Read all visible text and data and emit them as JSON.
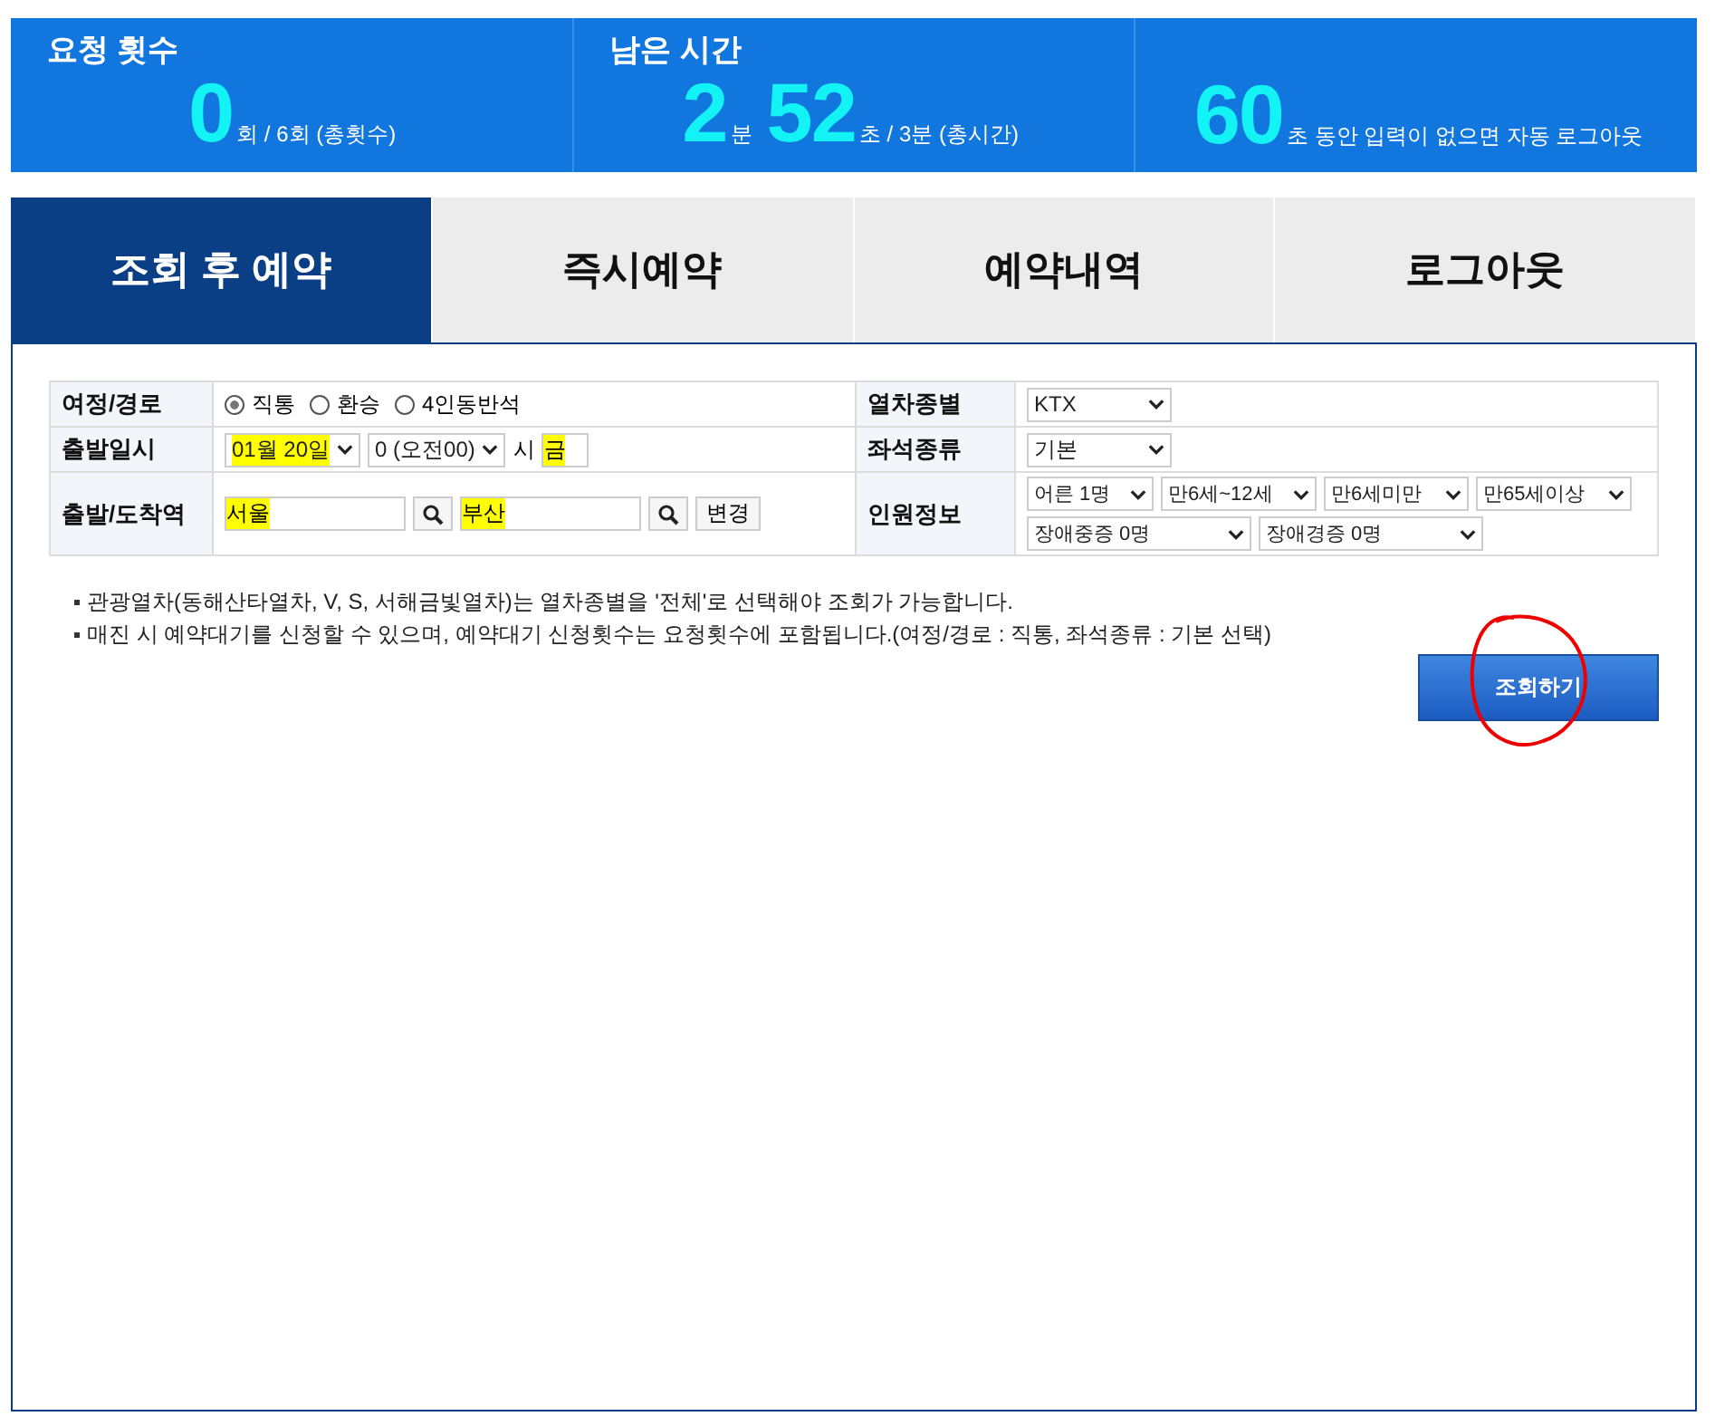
{
  "stats": [
    {
      "label": "요청 횟수",
      "parts": [
        {
          "kind": "big",
          "text": "0"
        },
        {
          "kind": "small",
          "text": "회 / 6회 (총횟수)"
        }
      ]
    },
    {
      "label": "남은 시간",
      "parts": [
        {
          "kind": "big",
          "text": "2"
        },
        {
          "kind": "small",
          "text": "분"
        },
        {
          "kind": "big",
          "text": "52"
        },
        {
          "kind": "small",
          "text": "초 / 3분 (총시간)"
        }
      ]
    },
    {
      "parts": [
        {
          "kind": "big",
          "text": "60"
        },
        {
          "kind": "small",
          "text": "초 동안 입력이 없으면 자동 로그아웃"
        }
      ]
    }
  ],
  "tabs": [
    {
      "label": "조회 후 예약",
      "selected": true
    },
    {
      "label": "즉시예약",
      "selected": false
    },
    {
      "label": "예약내역",
      "selected": false
    },
    {
      "label": "로그아웃",
      "selected": false
    }
  ],
  "form": {
    "rows": [
      {
        "label": "여정/경로",
        "controls": [
          {
            "kind": "radio",
            "options": [
              {
                "label": "직통",
                "selected": true
              },
              {
                "label": "환승",
                "selected": false
              },
              {
                "label": "4인동반석",
                "selected": false
              }
            ]
          }
        ],
        "label_2": "열차종별",
        "controls_2": [
          {
            "kind": "select",
            "value": "KTX",
            "highlighted": false
          }
        ]
      },
      {
        "label": "출발일시",
        "controls": [
          {
            "kind": "select",
            "value": "01월 20일",
            "highlighted": true
          },
          {
            "kind": "select",
            "value": "0 (오전00)",
            "highlighted": false
          },
          {
            "kind": "text",
            "text": "시"
          },
          {
            "kind": "input",
            "value": "금",
            "highlighted": true
          }
        ],
        "label_2": "좌석종류",
        "controls_2": [
          {
            "kind": "select",
            "value": "기본",
            "highlighted": false
          }
        ]
      },
      {
        "label": "출발/도착역",
        "controls": [
          {
            "kind": "input",
            "value": "서울",
            "highlighted": true
          },
          {
            "kind": "search"
          },
          {
            "kind": "input",
            "value": "부산",
            "highlighted": true
          },
          {
            "kind": "search"
          },
          {
            "kind": "button",
            "label": "변경"
          }
        ],
        "label_2": "인원정보",
        "controls_2": [
          {
            "kind": "select",
            "value": "어른 1명",
            "highlighted": false
          },
          {
            "kind": "select",
            "value": "만6세~12세",
            "highlighted": false
          },
          {
            "kind": "select",
            "value": "만6세미만",
            "highlighted": false
          },
          {
            "kind": "select",
            "value": "만65세이상",
            "highlighted": false
          },
          {
            "kind": "select",
            "value": "장애중증 0명",
            "highlighted": false
          },
          {
            "kind": "select",
            "value": "장애경증 0명",
            "highlighted": false
          }
        ]
      }
    ]
  },
  "notes": [
    "관광열차(동해산타열차, V, S, 서해금빛열차)는 열차종별을 '전체'로 선택해야 조회가 가능합니다.",
    "매진 시 예약대기를 신청할 수 있으며, 예약대기 신청횟수는 요청횟수에 포함됩니다.(여정/경로 : 직통, 좌석종류 : 기본 선택)"
  ],
  "search_button": {
    "label": "조회하기",
    "circled": true
  }
}
